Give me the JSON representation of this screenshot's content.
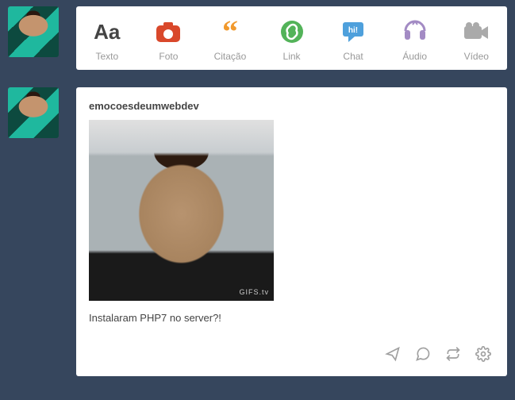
{
  "composer": {
    "items": [
      {
        "key": "texto",
        "label": "Texto",
        "icon": "text-icon",
        "color": "#444"
      },
      {
        "key": "foto",
        "label": "Foto",
        "icon": "camera-icon",
        "color": "#d9482b"
      },
      {
        "key": "citacao",
        "label": "Citação",
        "icon": "quote-icon",
        "color": "#f1992c"
      },
      {
        "key": "link",
        "label": "Link",
        "icon": "link-icon",
        "color": "#53b359"
      },
      {
        "key": "chat",
        "label": "Chat",
        "icon": "chat-icon",
        "color": "#4ea0dc"
      },
      {
        "key": "audio",
        "label": "Áudio",
        "icon": "audio-icon",
        "color": "#a38bc4"
      },
      {
        "key": "video",
        "label": "Vídeo",
        "icon": "video-icon",
        "color": "#aaa"
      }
    ]
  },
  "post": {
    "username": "emocoesdeumwebdev",
    "caption": "Instalaram PHP7 no server?!",
    "gif_watermark": "GIFS.tv"
  },
  "actions": [
    {
      "key": "send",
      "icon": "send-icon"
    },
    {
      "key": "reply",
      "icon": "reply-icon"
    },
    {
      "key": "reblog",
      "icon": "reblog-icon"
    },
    {
      "key": "settings",
      "icon": "gear-icon"
    }
  ]
}
